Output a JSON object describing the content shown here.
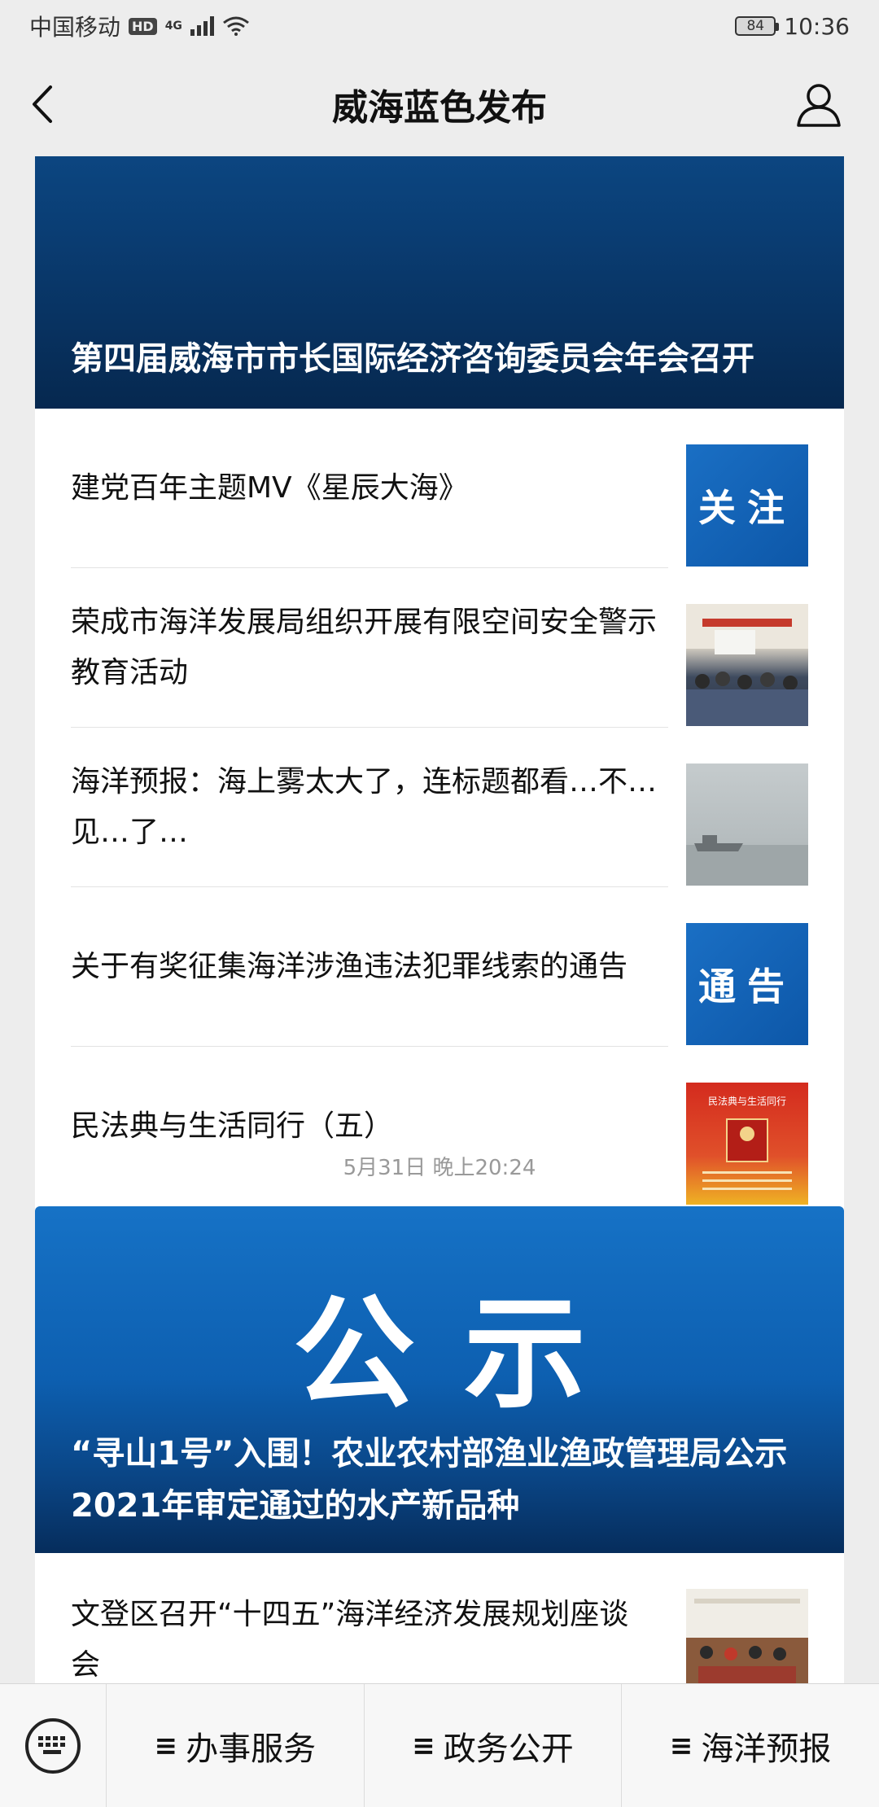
{
  "status_bar": {
    "carrier": "中国移动",
    "hd": "HD",
    "network": "4G",
    "battery": "84",
    "time": "10:36"
  },
  "header": {
    "title": "威海蓝色发布"
  },
  "article_group_1": {
    "banner_title": "第四届威海市市长国际经济咨询委员会年会召开",
    "items": [
      {
        "title": "建党百年主题MV《星辰大海》",
        "thumb_text": "关注"
      },
      {
        "title": "荣成市海洋发展局组织开展有限空间安全警示教育活动"
      },
      {
        "title": "海洋预报：海上雾太大了，连标题都看…不…见…了…"
      },
      {
        "title": "关于有奖征集海洋涉渔违法犯罪线索的通告",
        "thumb_text": "通告"
      },
      {
        "title": "民法典与生活同行（五）",
        "thumb_text": "民法典与生活同行"
      }
    ]
  },
  "timestamp": "5月31日 晚上20:24",
  "article_group_2": {
    "banner_word": "公示",
    "banner_title": "“寻山1号”入围！农业农村部渔业渔政管理局公示2021年审定通过的水产新品种",
    "items": [
      {
        "title": "文登区召开“十四五”海洋经济发展规划座谈会"
      }
    ]
  },
  "bottom_menu": {
    "items": [
      {
        "label": "办事服务"
      },
      {
        "label": "政务公开"
      },
      {
        "label": "海洋预报"
      }
    ]
  }
}
